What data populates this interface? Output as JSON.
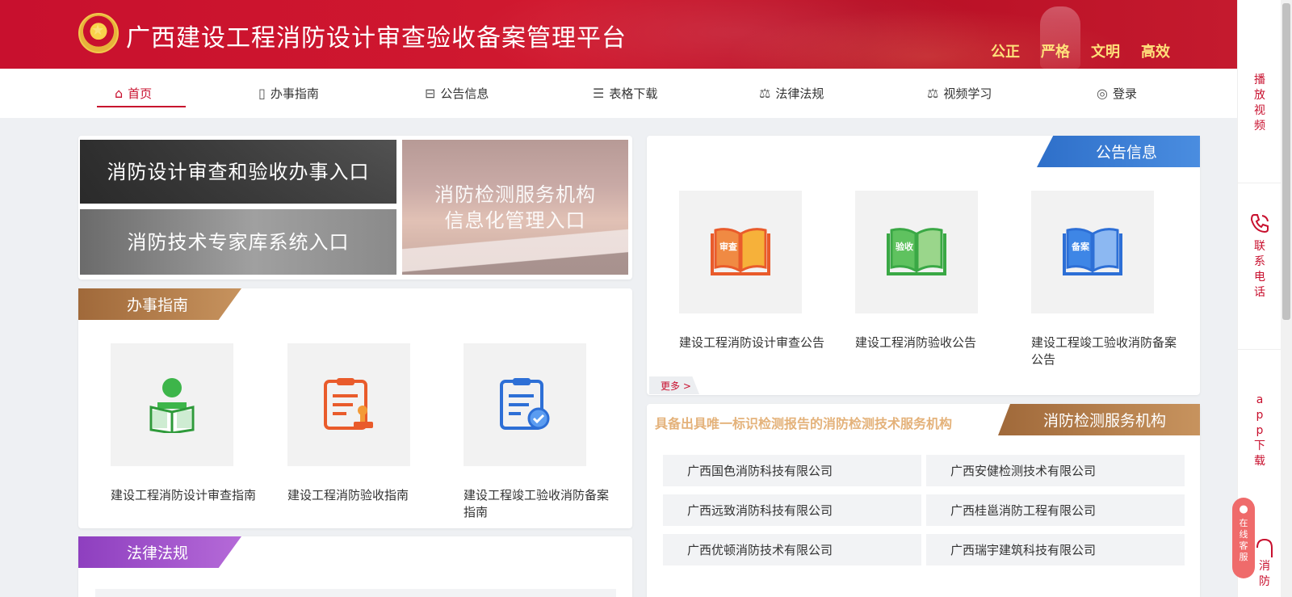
{
  "header": {
    "title": "广西建设工程消防设计审查验收备案管理平台",
    "motto": [
      "公正",
      "严格",
      "文明",
      "高效"
    ],
    "colors": {
      "brand_red": "#c8102e",
      "motto_gold": "#ffe07a"
    }
  },
  "nav": {
    "items": [
      {
        "label": "首页",
        "icon": "home-icon"
      },
      {
        "label": "办事指南",
        "icon": "document-icon"
      },
      {
        "label": "公告信息",
        "icon": "briefcase-icon"
      },
      {
        "label": "表格下载",
        "icon": "list-icon"
      },
      {
        "label": "法律法规",
        "icon": "gavel-icon"
      },
      {
        "label": "视频学习",
        "icon": "gavel-icon"
      },
      {
        "label": "登录",
        "icon": "user-icon"
      }
    ],
    "active": "首页"
  },
  "banners": {
    "b1": "消防设计审查和验收办事入口",
    "b2": "消防技术专家库系统入口",
    "b3_line1": "消防检测服务机构",
    "b3_line2": "信息化管理入口"
  },
  "guide": {
    "tag": "办事指南",
    "cards": [
      {
        "label": "建设工程消防设计审查指南",
        "icon": "reader-icon"
      },
      {
        "label": "建设工程消防验收指南",
        "icon": "clipboard-stamp-icon"
      },
      {
        "label": "建设工程竣工验收消防备案指南",
        "icon": "clipboard-check-icon"
      }
    ]
  },
  "law": {
    "tag": "法律法规"
  },
  "notice": {
    "tag": "公告信息",
    "cards": [
      {
        "label": "建设工程消防设计审查公告",
        "icon": "book-review-icon",
        "book_text": "审查"
      },
      {
        "label": "建设工程消防验收公告",
        "icon": "book-acceptance-icon",
        "book_text": "验收"
      },
      {
        "label": "建设工程竣工验收消防备案公告",
        "icon": "book-filing-icon",
        "book_text": "备案"
      }
    ],
    "more": "更多 >"
  },
  "testing": {
    "tag": "消防检测服务机构",
    "subtitle": "具备出具唯一标识检测报告的消防检测技术服务机构",
    "companies": [
      "广西国色消防科技有限公司",
      "广西安健检测技术有限公司",
      "广西远致消防科技有限公司",
      "广西桂邕消防工程有限公司",
      "广西优顿消防技术有限公司",
      "广西瑞宇建筑科技有限公司"
    ]
  },
  "sidebar": {
    "video": [
      "播",
      "放",
      "视",
      "频"
    ],
    "phone": [
      "联",
      "系",
      "电",
      "话"
    ],
    "app": [
      "a",
      "p",
      "p",
      "下",
      "载"
    ],
    "fire": [
      "消",
      "防"
    ],
    "chat": [
      "在",
      "线",
      "客",
      "服"
    ]
  }
}
